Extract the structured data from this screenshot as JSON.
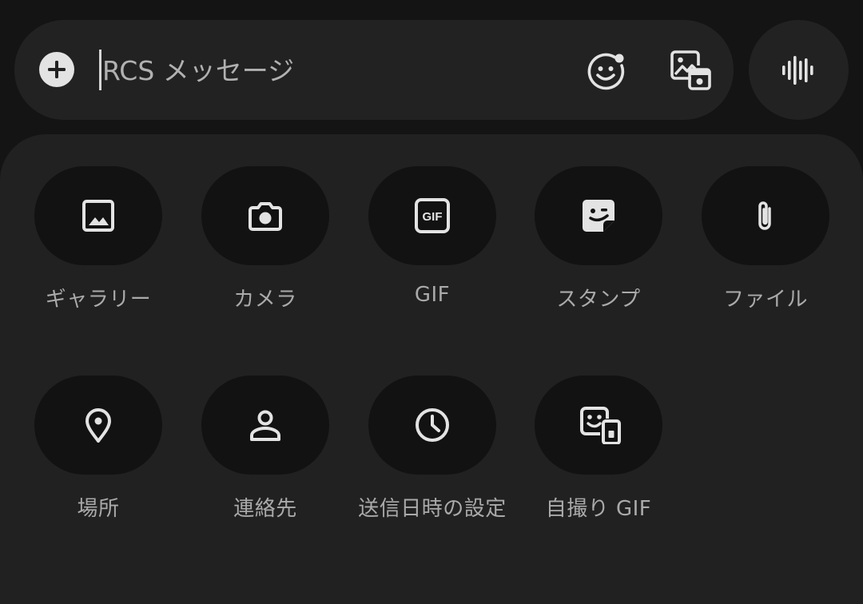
{
  "compose": {
    "placeholder": "RCS メッセージ"
  },
  "icons": {
    "add": "plus-circle-icon",
    "emoji": "emoji-icon",
    "media": "media-icon",
    "voice": "waveform-icon"
  },
  "colors": {
    "background": "#141414",
    "tray": "#212121",
    "option_pill": "#121212",
    "icon": "#e3e3e3",
    "label": "#aaaaaa"
  },
  "attachments": [
    {
      "label": "ギャラリー",
      "icon": "image-icon"
    },
    {
      "label": "カメラ",
      "icon": "camera-icon"
    },
    {
      "label": "GIF",
      "icon": "gif-icon"
    },
    {
      "label": "スタンプ",
      "icon": "sticker-icon"
    },
    {
      "label": "ファイル",
      "icon": "paperclip-icon"
    },
    {
      "label": "場所",
      "icon": "location-pin-icon"
    },
    {
      "label": "連絡先",
      "icon": "contact-icon"
    },
    {
      "label": "送信日時の設定",
      "icon": "clock-icon"
    },
    {
      "label": "自撮り GIF",
      "icon": "selfie-gif-icon"
    }
  ]
}
